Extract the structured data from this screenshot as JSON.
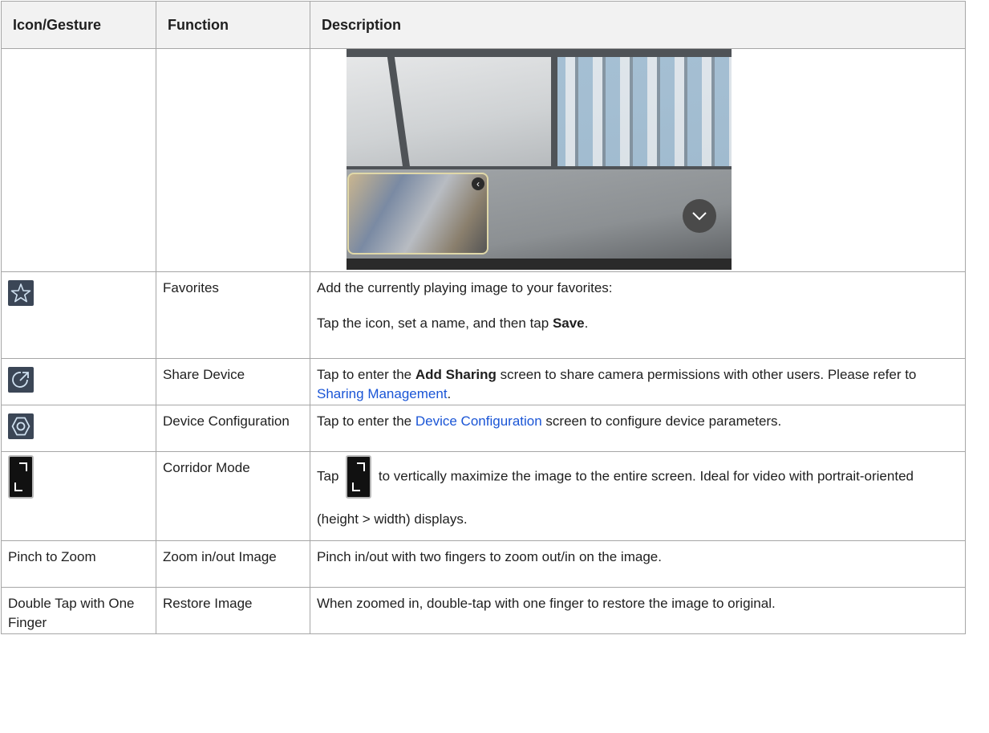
{
  "headers": [
    "Icon/Gesture",
    "Function",
    "Description"
  ],
  "rows": {
    "favorites": {
      "icon": "star-icon",
      "function": "Favorites",
      "desc_line1": "Add the currently playing image to your favorites:",
      "desc_line2_pre": "Tap the icon, set a name, and then tap ",
      "desc_line2_bold": "Save",
      "desc_line2_post": "."
    },
    "share": {
      "icon": "share-icon",
      "function": "Share Device",
      "desc_pre": "Tap to enter the ",
      "desc_bold": "Add Sharing",
      "desc_mid": " screen to share camera permissions with other users. Please refer to ",
      "desc_link": "Sharing Management",
      "desc_post": "."
    },
    "config": {
      "icon": "settings-icon",
      "function": "Device Configuration",
      "desc_pre": "Tap to enter the ",
      "desc_link": "Device Configuration",
      "desc_post": " screen to configure device parameters."
    },
    "corridor": {
      "icon": "corridor-mode-icon",
      "function": "Corridor Mode",
      "desc_pre": "Tap",
      "desc_post": "to vertically maximize the image to the entire screen. Ideal for video with portrait-oriented (height > width) displays."
    },
    "pinch": {
      "gesture": "Pinch to Zoom",
      "function": "Zoom in/out Image",
      "desc": "Pinch in/out with two fingers to zoom out/in on the image."
    },
    "doubletap": {
      "gesture": "Double Tap with One Finger",
      "function": "Restore Image",
      "desc": "When zoomed in, double-tap with one finger to restore the image to original."
    }
  },
  "colors": {
    "link": "#1a55d6",
    "header_bg": "#f2f2f2",
    "border": "#a6a6a6",
    "icon_tile": "#3b4656"
  }
}
